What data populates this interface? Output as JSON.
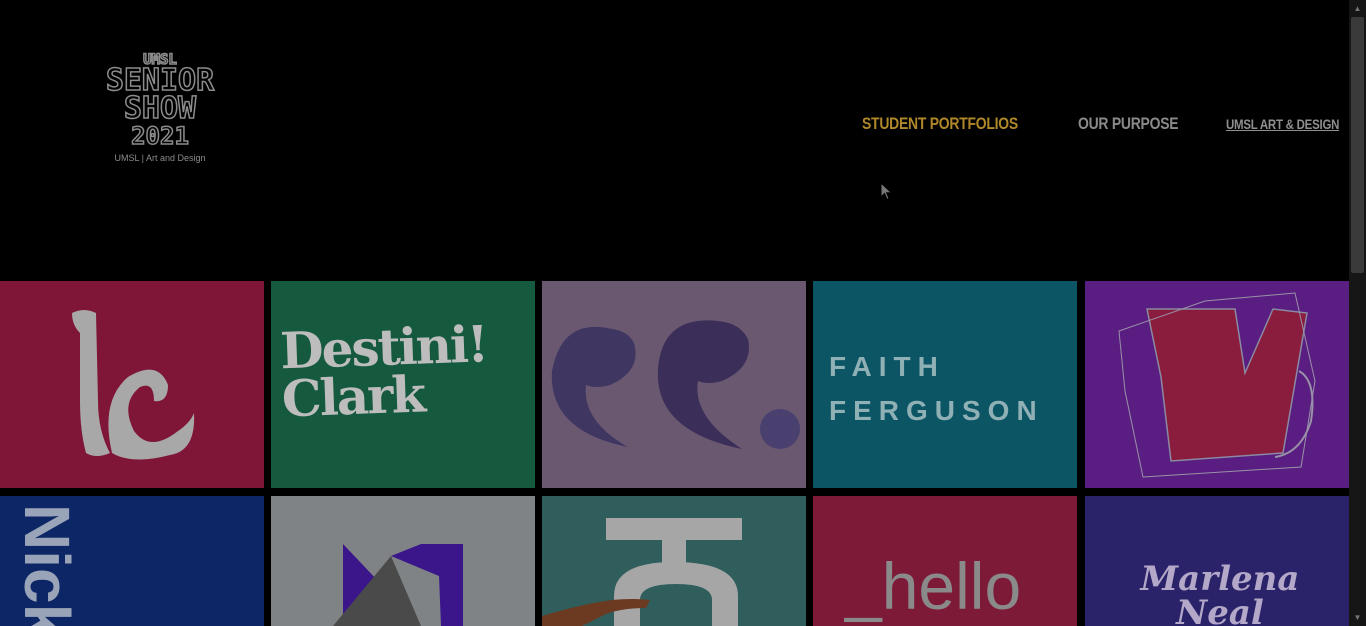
{
  "logo": {
    "lines": [
      "UMSL",
      "SENIOR",
      "SHOW",
      "2021"
    ],
    "subtitle": "UMSL | Art and Design"
  },
  "nav": {
    "items": [
      {
        "label": "STUDENT PORTFOLIOS",
        "active": true
      },
      {
        "label": "OUR PURPOSE",
        "active": false
      },
      {
        "label": "UMSL ART & DESIGN",
        "active": false,
        "external": true
      }
    ]
  },
  "portfolio_tiles": [
    {
      "name": "lc",
      "bg": "#7f1638"
    },
    {
      "name": "destini-clark",
      "bg": "#155a3e",
      "text": "Destini! Clark"
    },
    {
      "name": "cc",
      "bg": "#6a5870"
    },
    {
      "name": "faith-ferguson",
      "bg": "#0c5565",
      "text_lines": [
        "FAITH",
        "FERGUSON"
      ]
    },
    {
      "name": "kv",
      "bg": "#5a1d82"
    },
    {
      "name": "nick",
      "bg": "#0d2766",
      "text": "Nick"
    },
    {
      "name": "m-logo",
      "bg": "#7f8385"
    },
    {
      "name": "th",
      "bg": "#2f5e5c"
    },
    {
      "name": "hello",
      "bg": "#7c1a38",
      "text": "_hello"
    },
    {
      "name": "marlena-neal",
      "bg": "#2b236a",
      "text_lines": [
        "Marlena",
        "Neal"
      ]
    }
  ],
  "colors": {
    "accent": "#b0882a",
    "background": "#000000"
  }
}
